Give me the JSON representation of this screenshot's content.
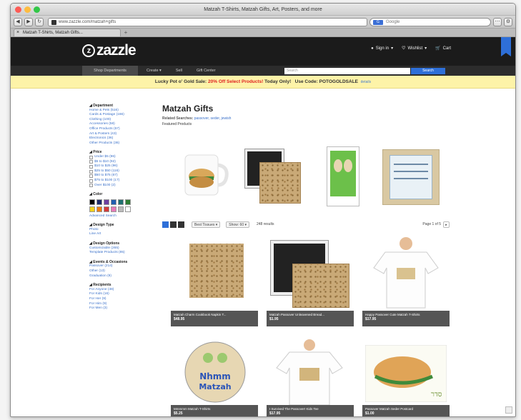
{
  "browser": {
    "window_title": "Matzah T-Shirts, Matzah Gifts, Art, Posters, and more",
    "url": "www.zazzle.com/matzah+gifts",
    "search_placeholder": "Google",
    "search_engine": "G",
    "tab_label": "Matzah T-Shirts, Matzah Gifts...",
    "back": "◀",
    "forward": "▶",
    "reload": "↻",
    "add_tab": "+"
  },
  "site": {
    "logo_text": "zazzle",
    "logo_mark": "z",
    "header_links": [
      "Sign in",
      "Wishlist",
      "Cart"
    ],
    "nav_items": [
      "Shop Departments",
      "Create",
      "Sell",
      "Gift Center"
    ],
    "search_placeholder": "Search",
    "search_button": "Search",
    "promo": {
      "prefix": "Lucky Pot o' Gold Sale:",
      "highlight": "20% Off Select Products!",
      "suffix": "Today Only!",
      "code": "Use Code: POTOGOLDSALE",
      "details": "details"
    }
  },
  "sidebar": {
    "department_title": "Department",
    "departments": [
      "Home & Pets (516)",
      "Cards & Postage (166)",
      "Clothing (100)",
      "Accessories (58)",
      "Office Products (57)",
      "Art & Posters (43)",
      "Electronics (36)",
      "Other Products (36)"
    ],
    "price_title": "Price",
    "prices": [
      "Under $5 (96)",
      "$5 to $10 (92)",
      "$10 to $25 (96)",
      "$25 to $50 (116)",
      "$50 to $75 (67)",
      "$75 to $100 (17)",
      "Over $100 (2)"
    ],
    "color_title": "Color",
    "colors": [
      "#000000",
      "#1b2a6b",
      "#6b3fa0",
      "#1f5fb0",
      "#1e6f6f",
      "#2e7d32",
      "#f2d21b",
      "#ef7d10",
      "#d23a3a",
      "#e67ab8",
      "#bbbbbb",
      "#ffffff"
    ],
    "color_link": "Advanced Search",
    "design_type_title": "Design Type",
    "design_types": [
      "Photo",
      "Line Art"
    ],
    "design_options_title": "Design Options",
    "design_options": [
      "Customizable (265)",
      "Template Products (85)"
    ],
    "events_title": "Events & Occasions",
    "events": [
      "Passover (214)",
      "Other (13)",
      "Graduation (9)"
    ],
    "recipients_title": "Recipients",
    "recipients": [
      "For Anyone (48)",
      "For Kids (16)",
      "For Her (9)",
      "For Him (9)",
      "For Men (3)"
    ]
  },
  "main": {
    "title": "Matzah Gifts",
    "related_label": "Related Searches:",
    "related_links": "passover, seder, jewish",
    "featured_label": "Featured Products",
    "sort_label": "Best Tissues ▾",
    "show_label": "Show: 60 ▾",
    "results": "248 results",
    "page_label": "Page 1 of 5",
    "next": "▸",
    "products": [
      {
        "title": "Matzah Charm Cookbook Napkin T...",
        "price": "$48.95"
      },
      {
        "title": "Matzah Passover Unleavened Bread...",
        "price": "$1.95"
      },
      {
        "title": "Happy Passover Cute Matzah T-Shirts",
        "price": "$17.95"
      },
      {
        "title": "Mmmmm Matzah T-Shirts",
        "price": "$5.25"
      },
      {
        "title": "I Survived The Passover! Kids Tee",
        "price": "$17.95"
      },
      {
        "title": "Passover Matzah Seder Postcard",
        "price": "$1.00"
      }
    ]
  }
}
